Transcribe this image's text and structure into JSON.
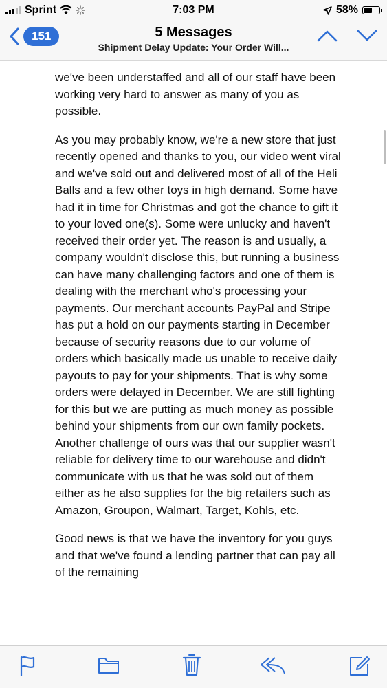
{
  "status_bar": {
    "carrier": "Sprint",
    "time": "7:03 PM",
    "battery_percent": "58%",
    "battery_level": 0.58,
    "icons": [
      "signal-bars-icon",
      "wifi-icon",
      "activity-spinner-icon",
      "location-arrow-icon",
      "battery-icon"
    ]
  },
  "nav": {
    "back_count": "151",
    "title": "5 Messages",
    "subtitle": "Shipment Delay Update: Your Order Will...",
    "icons": [
      "chevron-left-icon",
      "chevron-up-icon",
      "chevron-down-icon"
    ]
  },
  "email": {
    "paragraphs": [
      "we've been understaffed and all of our staff have been working very hard to answer as many of you as possible.",
      "As you may probably know, we're a new store that just recently opened and thanks to you, our video went viral and we've sold out and delivered most of all of the Heli Balls and a few other toys in high demand. Some have had it in time for Christmas and got the chance to gift it to your loved one(s). Some were unlucky and haven't received their order yet. The reason is and usually, a company wouldn't disclose this, but running a business can have many challenging factors and one of them is dealing with the merchant who's processing your payments. Our merchant accounts PayPal and Stripe has put a hold on our payments starting in December because of security reasons due to our volume of orders which basically made us unable to receive daily payouts to pay for your shipments. That is why some orders were delayed in December. We are still fighting for this but we are putting as much money as possible behind your shipments from our own family pockets. Another challenge of ours was that our supplier wasn't reliable for delivery time to our warehouse and didn't communicate with us that he was sold out of them either as he also supplies for the big retailers such as Amazon, Groupon, Walmart, Target, Kohls, etc.",
      "Good news is that we have the inventory for you guys and that we've found a lending partner that can pay all of the remaining"
    ]
  },
  "toolbar": {
    "icons": [
      "flag-icon",
      "folder-icon",
      "trash-icon",
      "reply-icon",
      "compose-icon"
    ],
    "accent": "#2f6fd6"
  },
  "colors": {
    "accent": "#2f6fd6",
    "bar_background": "#f7f7f7"
  }
}
